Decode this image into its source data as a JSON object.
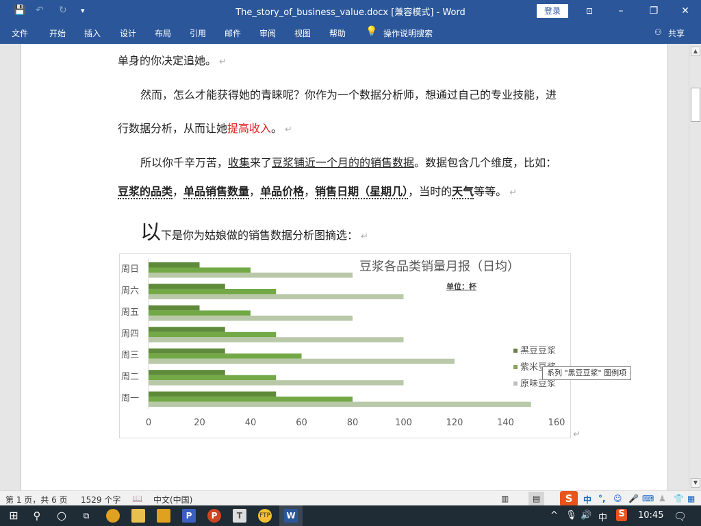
{
  "window": {
    "title": "The_story_of_business_value.docx [兼容模式]  -  Word",
    "login_label": "登录",
    "minimize": "–",
    "maximize": "❐",
    "close": "✕"
  },
  "quick_access": {
    "save_icon": "💾",
    "undo_icon": "↶",
    "redo_icon": "↻",
    "customize_icon": "▾"
  },
  "ribbon": {
    "tabs": [
      "文件",
      "开始",
      "插入",
      "设计",
      "布局",
      "引用",
      "邮件",
      "审阅",
      "视图",
      "帮助"
    ],
    "search_label": "操作说明搜索",
    "share_label": "共享"
  },
  "document": {
    "p1": "单身的你决定追她。",
    "p2_line1": "然而，怎么才能获得她的青睐呢？你作为一个数据分析师，想通过自己的专业技能，进",
    "p2_line2_a": "行数据分析，从而让她",
    "p2_line2_red": "提高收入",
    "p2_line2_b": "。",
    "p3_a": "所以你千辛万苦，",
    "p3_u1": "收集",
    "p3_b": "来了",
    "p3_u2": "豆浆铺近一个月的的销售数据",
    "p3_c": "。数据包含几个维度，比如：",
    "p4_b1": "豆浆的品类",
    "p4_s1": "，",
    "p4_b2": "单品销售数量",
    "p4_s2": "，",
    "p4_b3": "单品价格",
    "p4_s3": "，",
    "p4_b4": "销售日期（星期几）",
    "p4_s4": "，当时的",
    "p4_b5": "天气",
    "p4_s5": "等等。",
    "p5_big": "以",
    "p5_rest": "下是你为姑娘做的销售数据分析图摘选：",
    "pilcrow": "↵"
  },
  "chart_data": {
    "type": "bar",
    "orientation": "horizontal",
    "title": "豆浆各品类销量月报（日均）",
    "subtitle": "单位：杯",
    "categories": [
      "周一",
      "周二",
      "周三",
      "周四",
      "周五",
      "周六",
      "周日"
    ],
    "series": [
      {
        "name": "黑豆豆浆",
        "color": "#5f8a3a",
        "values": [
          50,
          30,
          30,
          30,
          20,
          30,
          20
        ]
      },
      {
        "name": "紫米豆浆",
        "color": "#72a846",
        "values": [
          80,
          50,
          60,
          50,
          40,
          50,
          40
        ]
      },
      {
        "name": "原味豆浆",
        "color": "#b9c8a8",
        "values": [
          150,
          100,
          120,
          100,
          80,
          100,
          80
        ]
      }
    ],
    "xlim": [
      0,
      160
    ],
    "xticks": [
      0,
      20,
      40,
      60,
      80,
      100,
      120,
      140,
      160
    ],
    "legend": "right",
    "grid": false
  },
  "tooltip": "系列 \"黑豆豆浆\" 图例项",
  "status": {
    "page": "第 1 页，共 6 页",
    "words": "1529 个字",
    "lang": "中文(中国)"
  },
  "ime": {
    "logo": "S",
    "mode": "中",
    "punct": "°,"
  },
  "taskbar": {
    "tray_lang": "中",
    "time": "10:45"
  }
}
